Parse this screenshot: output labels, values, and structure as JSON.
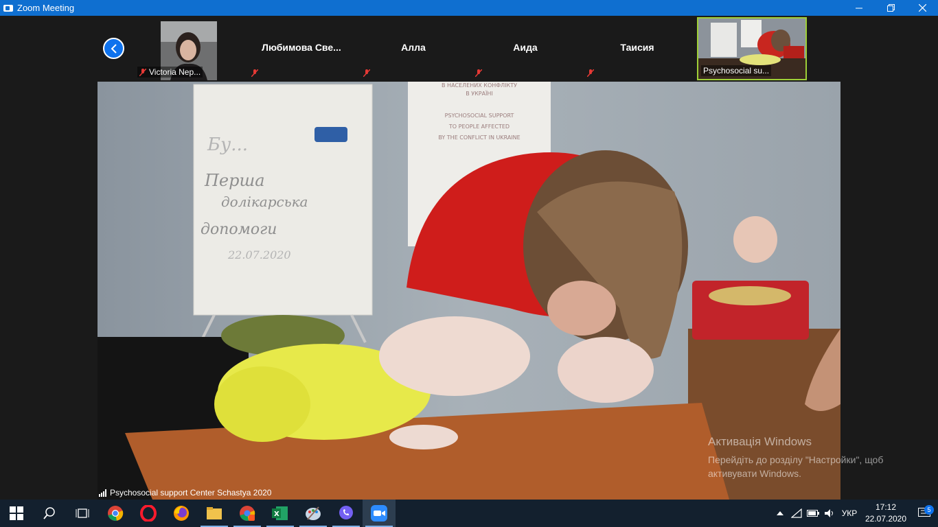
{
  "window": {
    "title": "Zoom Meeting"
  },
  "participants": [
    {
      "name": "Victoria Nep...",
      "label_position": "bottom",
      "has_video": true
    },
    {
      "name": "Любимова  Све...",
      "label_position": "center",
      "has_video": false
    },
    {
      "name": "Алла",
      "label_position": "center",
      "has_video": false
    },
    {
      "name": "Аида",
      "label_position": "center",
      "has_video": false
    },
    {
      "name": "Таисия",
      "label_position": "center",
      "has_video": false
    },
    {
      "name": "Psychosocial su...",
      "label_position": "bottom",
      "has_video": true,
      "active_speaker": true
    }
  ],
  "main_video": {
    "speaker": "Psychosocial support Center Schastya 2020",
    "whiteboard_text": [
      "Перша",
      "долікарська",
      "допомоги",
      "22.07.2020"
    ],
    "poster_text": [
      "В НАСЕЛЕНИХ КОНФЛІКТУ",
      "В УКРАЇНІ",
      "PSYCHOSOCIAL SUPPORT",
      "TO PEOPLE AFFECTED",
      "BY THE CONFLICT IN UKRAINE"
    ]
  },
  "activation": {
    "title": "Активація Windows",
    "line1": "Перейдіть до розділу \"Настройки\", щоб",
    "line2": "активувати Windows."
  },
  "tray": {
    "language": "УКР",
    "time": "17:12",
    "date": "22.07.2020",
    "notifications": "5"
  },
  "colors": {
    "titlebar": "#0f6fd0",
    "active_border": "#9fd037",
    "taskbar": "#13202e",
    "zoom_accent": "#0e72ed"
  }
}
